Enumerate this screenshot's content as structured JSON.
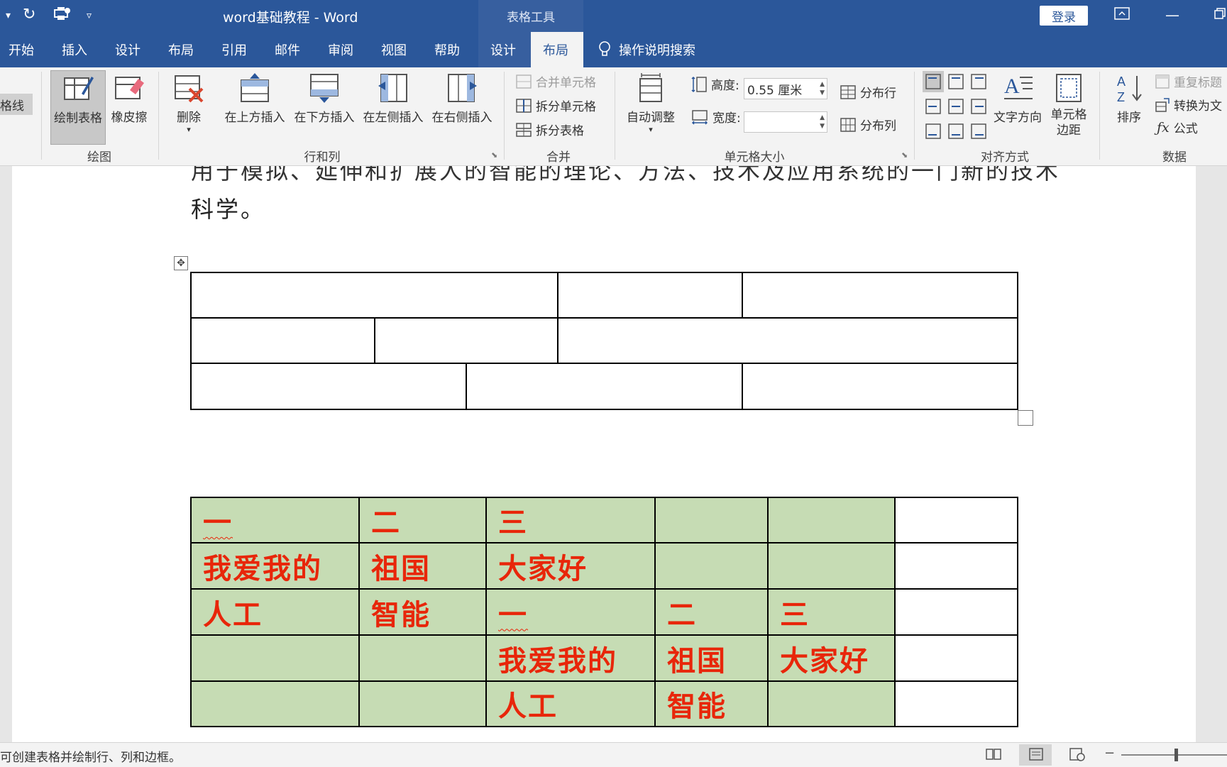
{
  "titlebar": {
    "doc_title": "word基础教程  -  Word",
    "context_group": "表格工具",
    "login": "登录"
  },
  "tabs": [
    "开始",
    "插入",
    "设计",
    "布局",
    "引用",
    "邮件",
    "审阅",
    "视图",
    "帮助",
    "设计",
    "布局"
  ],
  "active_tab_index": 10,
  "tell_me": "操作说明搜索",
  "ribbon": {
    "left_stub": "格线",
    "draw_group": {
      "label": "绘图",
      "draw_table": "绘制表格",
      "eraser": "橡皮擦"
    },
    "rows_cols_group": {
      "label": "行和列",
      "delete": "删除",
      "insert_above": "在上方插入",
      "insert_below": "在下方插入",
      "insert_left": "在左侧插入",
      "insert_right": "在右侧插入"
    },
    "merge_group": {
      "label": "合并",
      "merge_cells": "合并单元格",
      "split_cells": "拆分单元格",
      "split_table": "拆分表格"
    },
    "cell_size_group": {
      "label": "单元格大小",
      "autofit": "自动调整",
      "height_label": "高度:",
      "height_value": "0.55 厘米",
      "width_label": "宽度:",
      "width_value": "",
      "distribute_rows": "分布行",
      "distribute_cols": "分布列"
    },
    "align_group": {
      "label": "对齐方式",
      "text_direction": "文字方向",
      "cell_margins_1": "单元格",
      "cell_margins_2": "边距"
    },
    "data_group": {
      "label": "数据",
      "sort": "排序",
      "repeat_header": "重复标题",
      "convert_text": "转换为文",
      "formula": "公式"
    }
  },
  "document": {
    "line_cut": "用于模拟、延伸和扩展人的智能的理论、方法、技术及应用系统的一门新的技术",
    "line2": "科学。",
    "green_table": {
      "rows": [
        [
          "一",
          "二",
          "三",
          "",
          "",
          ""
        ],
        [
          "我爱我的",
          "祖国",
          "大家好",
          "",
          "",
          ""
        ],
        [
          "人工",
          "智能",
          "一",
          "二",
          "三",
          ""
        ],
        [
          "",
          "",
          "我爱我的",
          "祖国",
          "大家好",
          ""
        ],
        [
          "",
          "",
          "人工",
          "智能",
          "",
          ""
        ]
      ],
      "fill_color": "#c6dcb4",
      "text_color": "#e8260a"
    }
  },
  "statusbar": {
    "hint": "可创建表格并绘制行、列和边框。"
  },
  "colors": {
    "word_blue": "#2b579a",
    "context_blue": "#375f9f"
  }
}
